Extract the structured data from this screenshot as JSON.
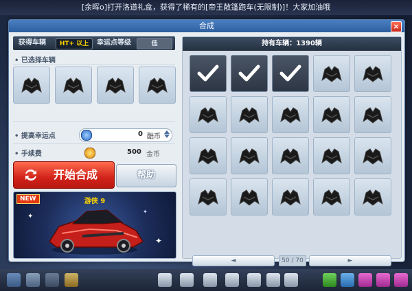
{
  "ticker": {
    "text": "[余晖o]打开洛道礼盒，获得了稀有的[帝王敞篷跑车(无限制)]！大家加油哦"
  },
  "window": {
    "title": "合成",
    "close_label": "×"
  },
  "left": {
    "obtain_label": "获得车辆",
    "obtain_value": "HT+ 以上",
    "luck_label": "幸运点等级",
    "luck_value": "低",
    "selected_label": "已选择车辆",
    "boost_label": "提高幸运点",
    "boost_value": "0",
    "boost_unit": "酷币",
    "fee_label": "手续费",
    "fee_value": "500",
    "fee_unit": "金币",
    "start_label": "开始合成",
    "help_label": "帮助",
    "new_badge": "NEW",
    "car_name": "游侠 9"
  },
  "right": {
    "header": "持有车辆：1390辆",
    "prev_label": "◄",
    "next_label": "►",
    "page_text": "50 / 70",
    "checked": [
      0,
      1,
      2
    ]
  },
  "colors": {
    "accent_red": "#d2231a",
    "title_blue": "#3a6fb0",
    "gold": "#f0a21a"
  }
}
